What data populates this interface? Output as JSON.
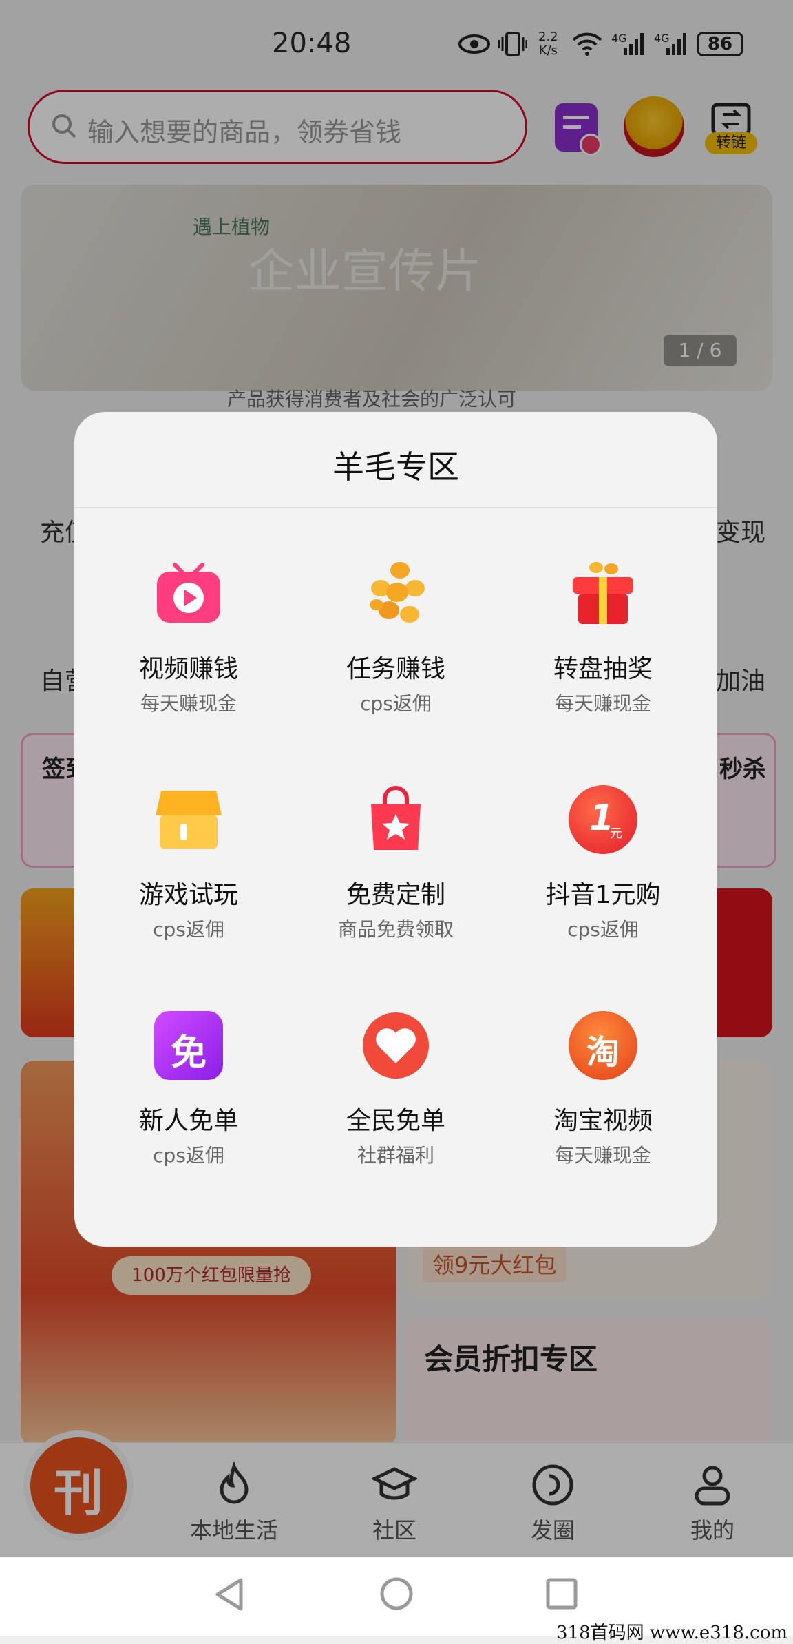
{
  "status_bar": {
    "time": "20:48",
    "net_speed_top": "2.2",
    "net_speed_unit": "K/s",
    "net1": "4G",
    "net2": "4G",
    "battery": "86"
  },
  "header": {
    "search_placeholder": "输入想要的商品，领券省钱",
    "convert_label": "转链"
  },
  "banner": {
    "title_watermark": "企业宣传片",
    "brand_cn": "遇上植物",
    "page_indicator": "1 / 6",
    "subtitle": "产品获得消费者及社会的广泛认可"
  },
  "background": {
    "left_label_1": "充值",
    "right_label_1": "变现",
    "left_label_2": "自营",
    "right_label_2": "加油",
    "card_left": "签到",
    "card_right": "秒杀",
    "promo_pill": "100万个红包限量抢",
    "promo_right": "领9元大红包",
    "member_zone": "会员折扣专区"
  },
  "modal": {
    "title": "羊毛专区",
    "items": [
      {
        "label": "视频赚钱",
        "sub": "每天赚现金",
        "icon": "video-tv-icon"
      },
      {
        "label": "任务赚钱",
        "sub": "cps返佣",
        "icon": "gold-coins-icon"
      },
      {
        "label": "转盘抽奖",
        "sub": "每天赚现金",
        "icon": "gift-box-icon"
      },
      {
        "label": "游戏试玩",
        "sub": "cps返佣",
        "icon": "shop-store-icon"
      },
      {
        "label": "免费定制",
        "sub": "商品免费领取",
        "icon": "shopping-bag-star-icon"
      },
      {
        "label": "抖音1元购",
        "sub": "cps返佣",
        "icon": "one-yuan-icon"
      },
      {
        "label": "新人免单",
        "sub": "cps返佣",
        "icon": "free-badge-icon"
      },
      {
        "label": "全民免单",
        "sub": "社群福利",
        "icon": "heart-icon"
      },
      {
        "label": "淘宝视频",
        "sub": "每天赚现金",
        "icon": "taobao-icon"
      }
    ],
    "one_yuan_glyph": "1",
    "one_yuan_unit": "元",
    "free_glyph": "免",
    "taobao_glyph": "淘"
  },
  "bottom_nav": {
    "items": [
      {
        "label": "本地生活",
        "icon": "flame-icon"
      },
      {
        "label": "社区",
        "icon": "graduation-cap-icon"
      },
      {
        "label": "发圈",
        "icon": "circle-share-icon"
      },
      {
        "label": "我的",
        "icon": "person-icon"
      }
    ],
    "home_glyph": "刊"
  },
  "watermark": "318首码网  www.e318.com",
  "colors": {
    "accent_red": "#d0102a",
    "orange": "#e9521d"
  }
}
